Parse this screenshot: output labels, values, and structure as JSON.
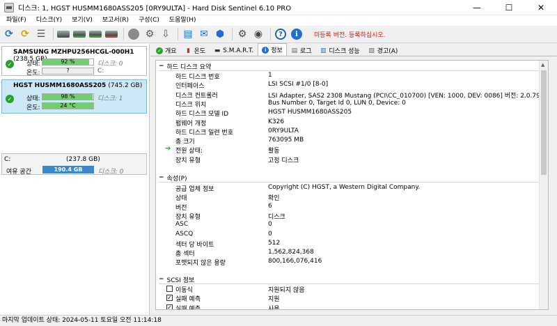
{
  "window": {
    "title": "디스크: 1, HGST    HUSMM1680ASS205 [0RY9ULTA]  -  Hard Disk Sentinel 6.10 PRO",
    "minimize": "—",
    "maximize": "☐",
    "close": "✕"
  },
  "menu": [
    "파일(F)",
    "디스크(Y)",
    "보기(V)",
    "보고서(R)",
    "구성(C)",
    "도움말(H)"
  ],
  "toolbar": {
    "update_notice": "미등록 버전. 등록하십시오."
  },
  "disks": [
    {
      "name": "SAMSUNG MZHPU256HCGL-000H1",
      "size": "(238.5 GB)",
      "status_label": "상태:",
      "health": "92 %",
      "health_pct": 92,
      "temp_label": "온도:",
      "temperature": "?",
      "disk_ref": "디스크: 0",
      "drive_ref": "C:"
    },
    {
      "name": "HGST    HUSMM1680ASS205",
      "size": "(745.2 GB)",
      "status_label": "상태:",
      "health": "98 %",
      "health_pct": 98,
      "temp_label": "온도:",
      "temperature": "24 °C",
      "disk_ref": "디스크: 1"
    }
  ],
  "volume": {
    "name": "C:",
    "size": "(237.8 GB)",
    "free_label": "여유 공간",
    "free": "190.4 GB",
    "disk_ref": "디스크: 0"
  },
  "tabs": [
    "개요",
    "온도",
    "S.M.A.R.T.",
    "정보",
    "로그",
    "디스크 성능",
    "경고(A)"
  ],
  "sections": {
    "summary": {
      "title": "하드 디스크 요약",
      "rows": [
        {
          "k": "하드 디스크 번호",
          "v": "1"
        },
        {
          "k": "인터페이스",
          "v": "LSI  SCSI #1/0 [8-0]"
        },
        {
          "k": "디스크 컨트롤러",
          "v": "LSI Adapter, SAS2 2308 Mustang (PCI\\CC_010700) [VEN: 1000, DEV: 0086] 버전: 2.0.79.82, 8-2-2017"
        },
        {
          "k": "디스크 위치",
          "v": "Bus Number 0, Target Id 0, LUN 0, Device: 0"
        },
        {
          "k": "하드 디스크 모델 ID",
          "v": "HGST    HUSMM1680ASS205"
        },
        {
          "k": "펌웨어 개정",
          "v": "K326"
        },
        {
          "k": "하드 디스크 일련 번호",
          "v": "0RY9ULTA"
        },
        {
          "k": "총 크기",
          "v": "763095 MB"
        },
        {
          "k": "전원 상태:",
          "v": "활동"
        },
        {
          "k": "장치 유형",
          "v": "고정 디스크"
        }
      ]
    },
    "properties": {
      "title": "속성(P)",
      "rows": [
        {
          "k": "공급 업체 정보",
          "v": "Copyright (C) HGST, a Western Digital Company."
        },
        {
          "k": "상태",
          "v": "확인"
        },
        {
          "k": "버전",
          "v": "6"
        },
        {
          "k": "장치 유형",
          "v": "디스크"
        },
        {
          "k": "ASC",
          "v": "0"
        },
        {
          "k": "ASCQ",
          "v": "0"
        },
        {
          "k": "섹터 당 바이트",
          "v": "512"
        },
        {
          "k": "총 섹터",
          "v": "1,562,824,368"
        },
        {
          "k": "포맷되지 않은 용량",
          "v": "800,166,076,416"
        }
      ]
    },
    "scsi": {
      "title": "SCSI 정보",
      "rows": [
        {
          "k": "이동식",
          "v": "지원되지 않음",
          "checked": ""
        },
        {
          "k": "실패 예측",
          "v": "지원",
          "checked": "✓"
        },
        {
          "k": "실패 예측",
          "v": "사용",
          "checked": "✓"
        }
      ]
    }
  },
  "status_bar": "마지막 업데이트 상태: 2024-05-11 토요일 오전 11:14:18"
}
